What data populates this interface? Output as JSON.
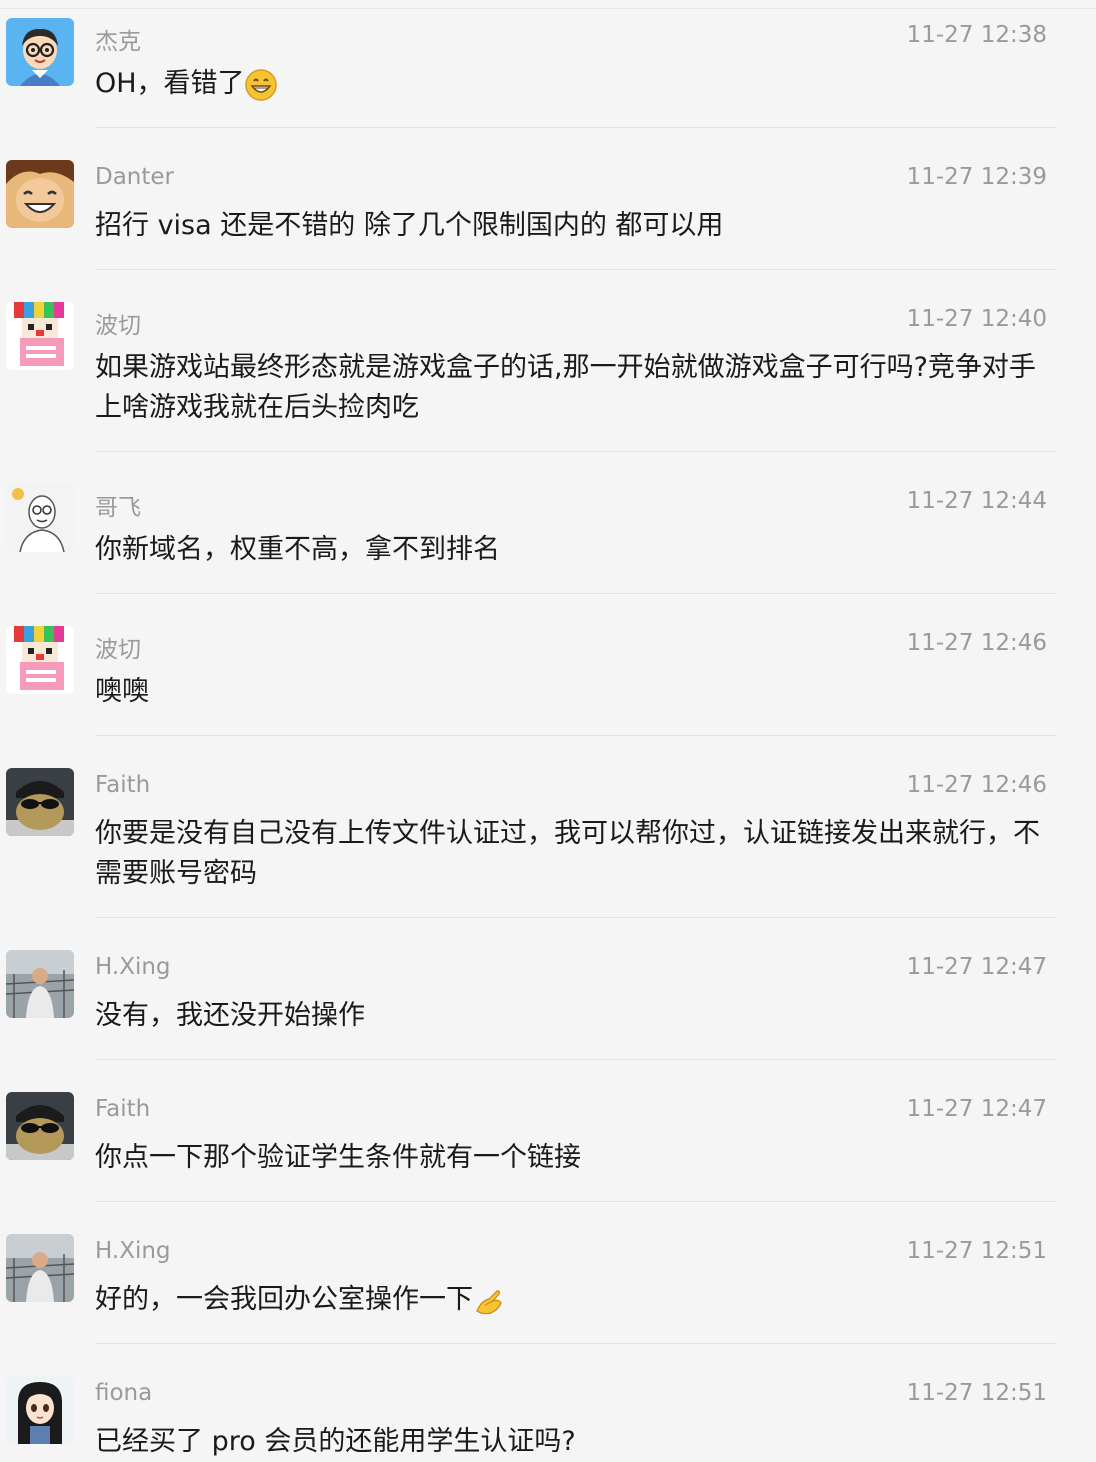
{
  "messages": [
    {
      "sender": "杰克",
      "time": "11-27 12:38",
      "text": "OH，看错了",
      "emoji": "grinning-face-icon",
      "avatar": "cartoon-boy-glasses-avatar"
    },
    {
      "sender": "Danter",
      "time": "11-27 12:39",
      "text": "招行 visa 还是不错的 除了几个限制国内的 都可以用",
      "avatar": "anime-smile-avatar"
    },
    {
      "sender": "波切",
      "time": "11-27 12:40",
      "text": "如果游戏站最终形态就是游戏盒子的话,那一开始就做游戏盒子可行吗?竞争对手上啥游戏我就在后头捡肉吃",
      "avatar": "pixel-clown-avatar"
    },
    {
      "sender": "哥飞",
      "time": "11-27 12:44",
      "text": "你新域名，权重不高，拿不到排名",
      "avatar": "sketch-man-avatar"
    },
    {
      "sender": "波切",
      "time": "11-27 12:46",
      "text": "噢噢",
      "avatar": "pixel-clown-avatar"
    },
    {
      "sender": "Faith",
      "time": "11-27 12:46",
      "text": "你要是没有自己没有上传文件认证过，我可以帮你过，认证链接发出来就行，不需要账号密码",
      "avatar": "sunglasses-plush-avatar"
    },
    {
      "sender": "H.Xing",
      "time": "11-27 12:47",
      "text": "没有，我还没开始操作",
      "avatar": "photo-man-avatar"
    },
    {
      "sender": "Faith",
      "time": "11-27 12:47",
      "text": "你点一下那个验证学生条件就有一个链接",
      "avatar": "sunglasses-plush-avatar"
    },
    {
      "sender": "H.Xing",
      "time": "11-27 12:51",
      "text": "好的，一会我回办公室操作一下",
      "emoji": "ok-hand-icon",
      "avatar": "photo-man-avatar"
    },
    {
      "sender": "fiona",
      "time": "11-27 12:51",
      "text": "已经买了 pro 会员的还能用学生认证吗?",
      "avatar": "anime-girl-avatar"
    }
  ],
  "colors": {
    "background": "#f5f5f5",
    "meta_text": "#9a9a9a",
    "body_text": "#1a1a1a",
    "divider": "#e3e3e3"
  }
}
